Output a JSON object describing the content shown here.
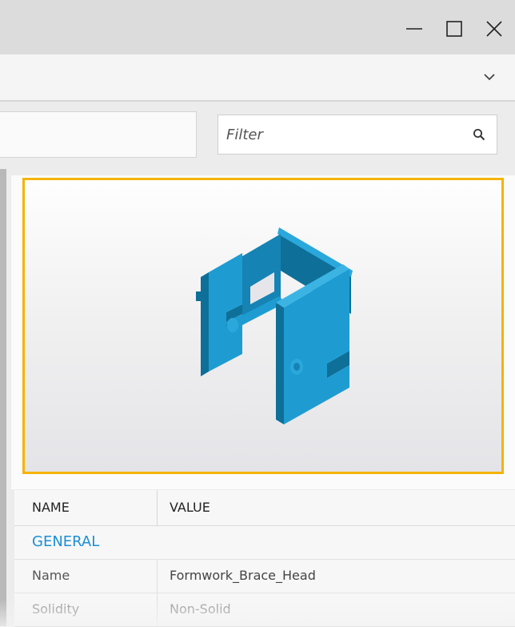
{
  "window": {
    "controls": {
      "minimize_icon": "minimize-icon",
      "maximize_icon": "maximize-icon",
      "close_icon": "close-icon"
    }
  },
  "toolbar": {
    "expand_icon": "chevron-down-icon"
  },
  "search": {
    "filter_placeholder": "Filter",
    "search_icon": "search-icon"
  },
  "preview": {
    "accent_color": "#f5b300",
    "model_color": "#1e9cd2"
  },
  "properties": {
    "columns": {
      "name": "NAME",
      "value": "VALUE"
    },
    "group_label": "GENERAL",
    "group_color": "#1a8fd6",
    "rows": [
      {
        "key": "Name",
        "value": "Formwork_Brace_Head"
      },
      {
        "key": "Solidity",
        "value": "Non-Solid"
      }
    ]
  }
}
